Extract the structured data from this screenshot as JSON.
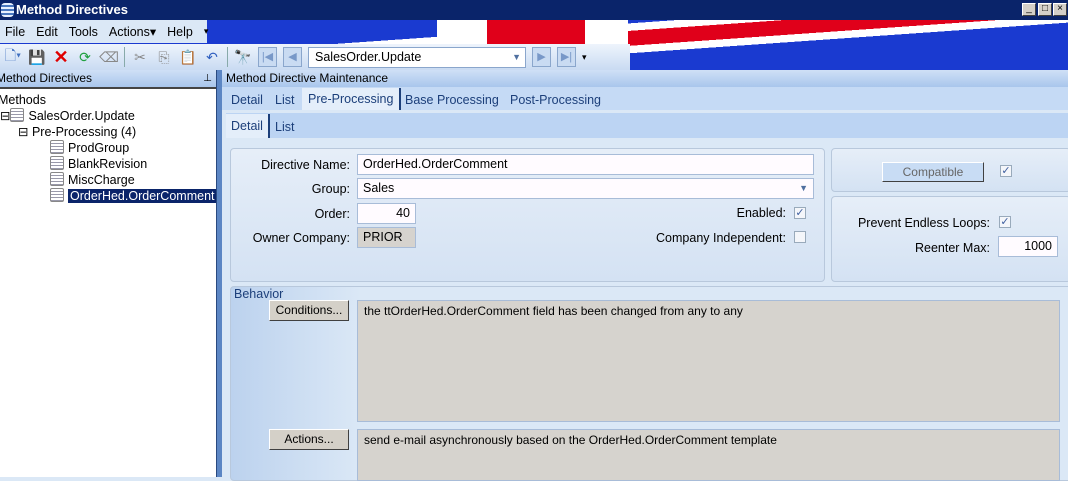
{
  "window": {
    "title": "Method Directives",
    "min": "_",
    "max": "□",
    "close": "×"
  },
  "menu": [
    "File",
    "Edit",
    "Tools",
    "Actions▾",
    "Help"
  ],
  "toolbar": {
    "search_value": "SalesOrder.Update"
  },
  "left_panel": {
    "title": "Method Directives",
    "pin": "⊥",
    "tree": {
      "root": "Methods",
      "method": "SalesOrder.Update",
      "group": "Pre-Processing (4)",
      "items": [
        "ProdGroup",
        "BlankRevision",
        "MiscCharge",
        "OrderHed.OrderComment"
      ],
      "selected": "OrderHed.OrderComment"
    }
  },
  "right_panel": {
    "title": "Method Directive Maintenance",
    "tabs": [
      "Detail",
      "List",
      "Pre-Processing",
      "Base Processing",
      "Post-Processing"
    ],
    "active_tab": "Pre-Processing",
    "subtabs": [
      "Detail",
      "List"
    ],
    "active_subtab": "Detail"
  },
  "form": {
    "directive_name_label": "Directive Name:",
    "directive_name": "OrderHed.OrderComment",
    "group_label": "Group:",
    "group": "Sales",
    "order_label": "Order:",
    "order": "40",
    "owner_label": "Owner Company:",
    "owner": "PRIOR",
    "enabled_label": "Enabled:",
    "enabled": true,
    "company_independent_label": "Company Independent:",
    "company_independent": false,
    "compatible_label": "Compatible",
    "compatible": true,
    "prevent_loops_label": "Prevent Endless Loops:",
    "prevent_loops": true,
    "reenter_label": "Reenter Max:",
    "reenter": "1000"
  },
  "behavior": {
    "title": "Behavior",
    "conditions_button": "Conditions...",
    "conditions_text": "the ttOrderHed.OrderComment field has been changed from any to any",
    "actions_button": "Actions...",
    "actions_text": "send e-mail asynchronously based on the OrderHed.OrderComment template"
  }
}
